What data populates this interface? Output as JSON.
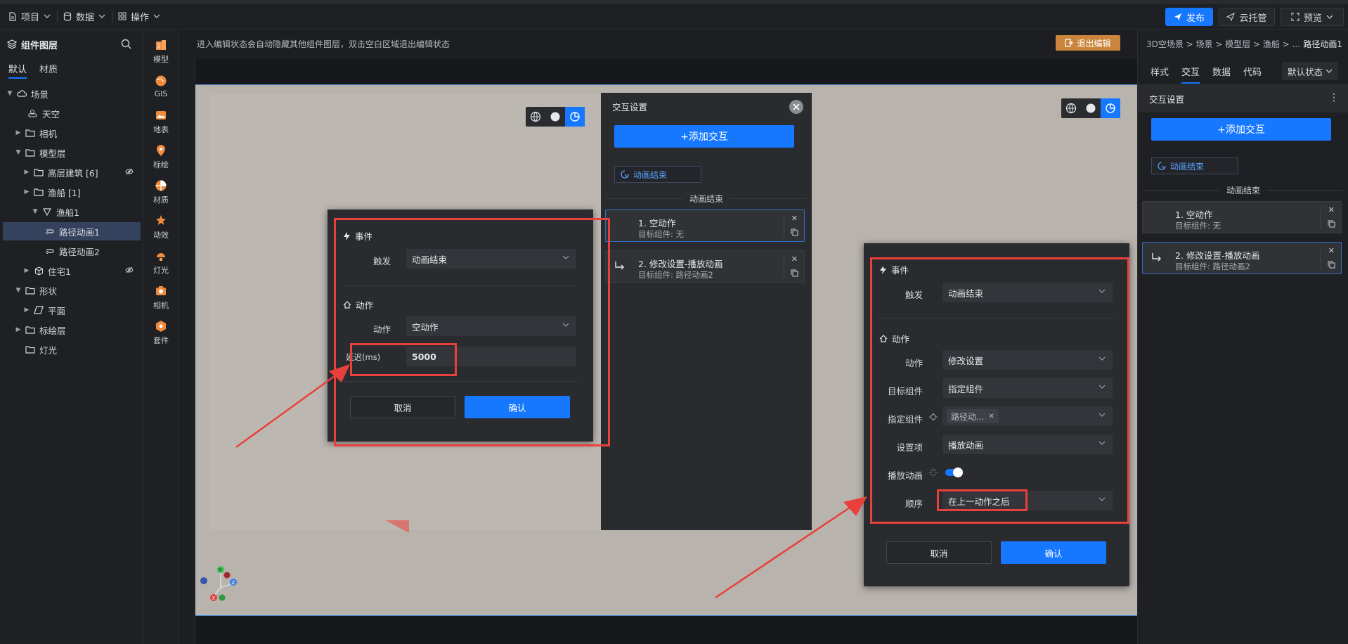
{
  "topbar": {
    "menus": [
      "项目",
      "数据",
      "操作"
    ],
    "publish": "发布",
    "cloud": "云托管",
    "preview": "预览"
  },
  "layers": {
    "title": "组件图层",
    "tabs": [
      "默认",
      "材质"
    ],
    "items": [
      {
        "label": "场景",
        "icon": "cloud-icon",
        "expanded": true
      },
      {
        "label": "天空",
        "icon": "sky-icon"
      },
      {
        "label": "相机",
        "icon": "folder-icon"
      },
      {
        "label": "模型层",
        "icon": "folder-icon",
        "expanded": true
      },
      {
        "label": "高层建筑 [6]",
        "icon": "folder-icon"
      },
      {
        "label": "渔船 [1]",
        "icon": "folder-icon",
        "expanded": true
      },
      {
        "label": "渔船1",
        "icon": "triangle-icon",
        "expanded": true
      },
      {
        "label": "路径动画1",
        "icon": "path-icon",
        "selected": true
      },
      {
        "label": "路径动画2",
        "icon": "path-icon"
      },
      {
        "label": "住宅1",
        "icon": "cube-icon"
      },
      {
        "label": "形状",
        "icon": "folder-icon",
        "expanded": true
      },
      {
        "label": "平面",
        "icon": "plane-icon"
      },
      {
        "label": "标绘层",
        "icon": "folder-icon"
      },
      {
        "label": "灯光",
        "icon": "folder-icon"
      }
    ]
  },
  "tools": [
    "模型",
    "GIS",
    "地表",
    "标绘",
    "材质",
    "动效",
    "灯光",
    "相机",
    "套件"
  ],
  "canvas": {
    "hint": "进入编辑状态会自动隐藏其他组件图层，双击空白区域退出编辑状态",
    "exit": "退出编辑"
  },
  "center_panel": {
    "title": "交互设置",
    "add": "+添加交互",
    "trigger": "动画结束",
    "divider": "动画结束",
    "actions": [
      {
        "title": "1. 空动作",
        "sub": "目标组件: 无"
      },
      {
        "title": "2. 修改设置-播放动画",
        "sub": "目标组件: 路径动画2"
      }
    ]
  },
  "modal_left": {
    "event_section": "事件",
    "trigger_label": "触发",
    "trigger_value": "动画结束",
    "action_section": "动作",
    "action_label": "动作",
    "action_value": "空动作",
    "delay_label": "延迟(ms)",
    "delay_value": "5000",
    "cancel": "取消",
    "ok": "确认"
  },
  "modal_right": {
    "event_section": "事件",
    "trigger_label": "触发",
    "trigger_value": "动画结束",
    "action_section": "动作",
    "action_label": "动作",
    "action_value": "修改设置",
    "target_label": "目标组件",
    "target_value": "指定组件",
    "spec_label": "指定组件",
    "spec_tag": "路径动...",
    "setting_label": "设置项",
    "setting_value": "播放动画",
    "play_label": "播放动画",
    "order_label": "顺序",
    "order_value": "在上一动作之后",
    "cancel": "取消",
    "ok": "确认"
  },
  "right_panel": {
    "breadcrumb": "3D空场景 > 场景 > 模型层 > 渔船 > ...",
    "current": "路径动画1",
    "tabs": [
      "样式",
      "交互",
      "数据",
      "代码"
    ],
    "state": "默认状态",
    "ix_title": "交互设置",
    "add": "+添加交互",
    "trigger": "动画结束",
    "divider": "动画结束",
    "actions": [
      {
        "title": "1. 空动作",
        "sub": "目标组件: 无"
      },
      {
        "title": "2. 修改设置-播放动画",
        "sub": "目标组件: 路径动画2"
      }
    ]
  },
  "colors": {
    "accent": "#1677ff",
    "highlight": "#e8403a",
    "exit": "#c9853b"
  }
}
